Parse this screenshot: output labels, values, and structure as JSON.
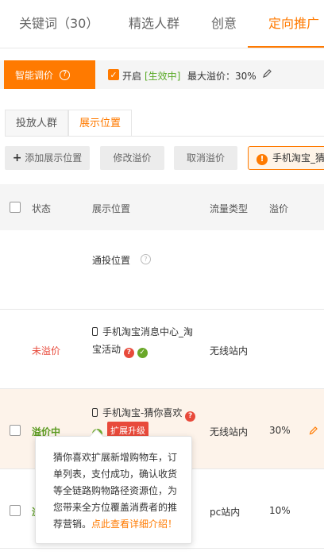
{
  "tabs": [
    {
      "label": "关键词（30）"
    },
    {
      "label": "精选人群"
    },
    {
      "label": "创意"
    },
    {
      "label": "定向推广"
    }
  ],
  "smart": {
    "label": "智能调价",
    "enable_label": "开启",
    "status": "[生效中]",
    "max_premium": "最大溢价：30%"
  },
  "subtabs": [
    "投放人群",
    "展示位置"
  ],
  "toolbar": {
    "add": "添加展示位置",
    "modify": "修改溢价",
    "cancel": "取消溢价",
    "warning": "手机淘宝_猜你喜欢"
  },
  "table": {
    "headers": [
      "状态",
      "展示位置",
      "流量类型",
      "溢价"
    ],
    "rows": [
      {
        "status": "",
        "place": "通投位置",
        "traffic": "",
        "premium": ""
      },
      {
        "status": "未溢价",
        "place_line1": "手机淘宝消息中心_淘",
        "place_line2": "宝活动",
        "traffic": "无线站内",
        "premium": ""
      },
      {
        "status": "溢价中",
        "place": "手机淘宝-猜你喜欢",
        "badge": "扩展升级",
        "traffic": "无线站内",
        "premium": "30%"
      },
      {
        "status": "溢",
        "traffic": "pc站内",
        "premium": "10%"
      }
    ]
  },
  "tooltip": {
    "text": "猜你喜欢扩展新增购物车，订单列表，支付成功，确认收货等全链路购物路径资源位，为您带来全方位覆盖消费者的推荐营销。",
    "link": "点此查看详细介绍！"
  },
  "colors": {
    "accent": "#ff7a00",
    "danger": "#e84a3b",
    "success": "#6aa829"
  }
}
